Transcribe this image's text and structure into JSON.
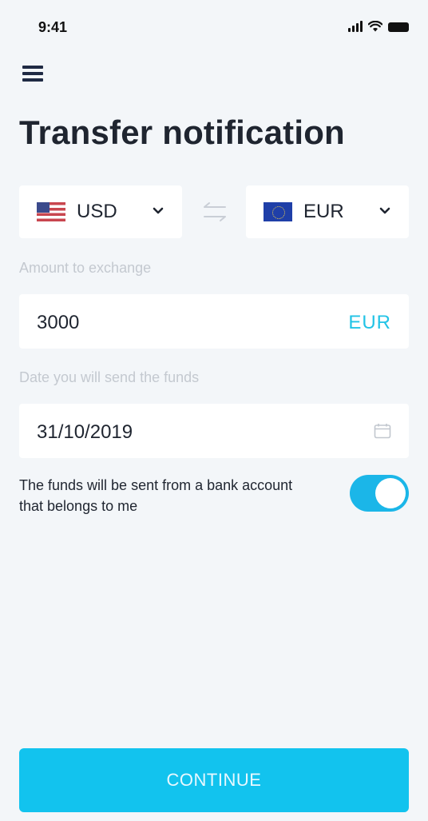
{
  "status_bar": {
    "time": "9:41",
    "icons": [
      "signal-icon",
      "wifi-icon",
      "battery-icon"
    ]
  },
  "header": {
    "menu_icon": "hamburger-menu-icon",
    "title": "Transfer notification"
  },
  "exchange": {
    "from": {
      "code": "USD",
      "flag": "us-flag"
    },
    "to": {
      "code": "EUR",
      "flag": "eu-flag"
    },
    "swap_icon": "swap-arrows-icon"
  },
  "amount": {
    "label": "Amount to exchange",
    "value": "3000",
    "currency": "EUR"
  },
  "date": {
    "label": "Date you will send the funds",
    "value": "31/10/2019",
    "icon": "calendar-icon"
  },
  "ownership": {
    "text": "The funds will be sent from a bank account that belongs to me",
    "enabled": true
  },
  "actions": {
    "continue_label": "CONTINUE"
  },
  "colors": {
    "accent": "#12c3ee",
    "toggle_on": "#1bb6e8",
    "background": "#f3f6f9",
    "text": "#1f2530",
    "label": "#c4c9d0"
  }
}
